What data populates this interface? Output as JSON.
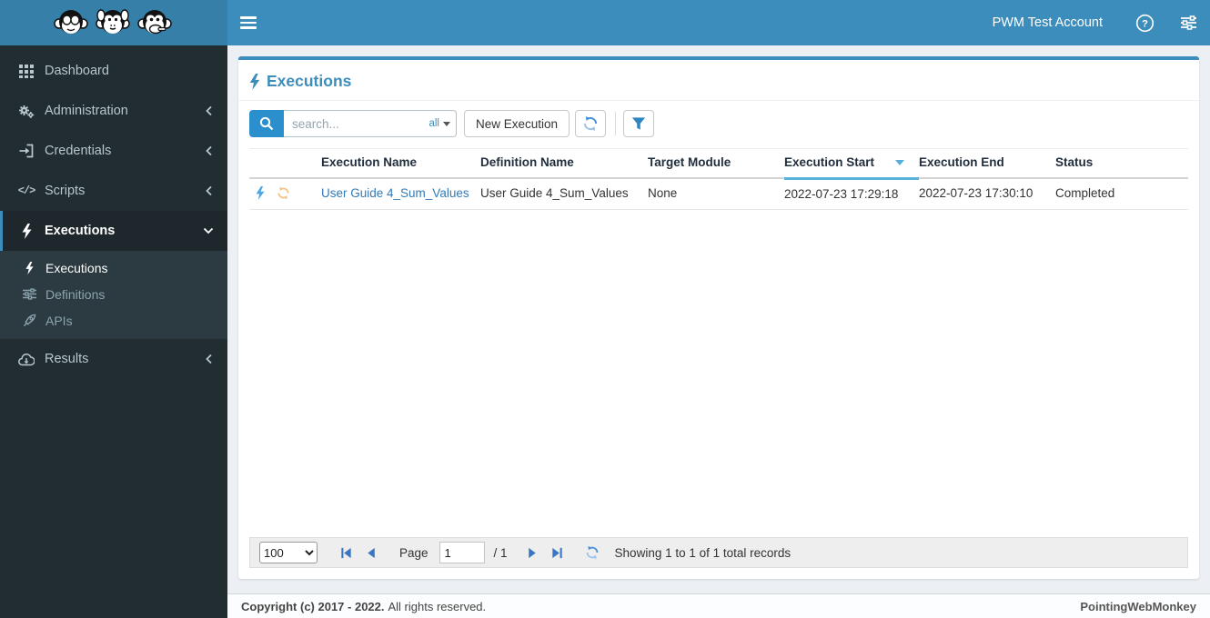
{
  "header": {
    "account_label": "PWM Test Account"
  },
  "sidebar": {
    "items": [
      {
        "label": "Dashboard",
        "icon": "grid-icon"
      },
      {
        "label": "Administration",
        "icon": "gears-icon",
        "chevron": "left"
      },
      {
        "label": "Credentials",
        "icon": "sign-in-icon",
        "chevron": "left"
      },
      {
        "label": "Scripts",
        "icon": "code-icon",
        "chevron": "left"
      },
      {
        "label": "Executions",
        "icon": "bolt-icon",
        "chevron": "down",
        "active": true
      },
      {
        "label": "Results",
        "icon": "cloud-download-icon",
        "chevron": "left"
      }
    ],
    "subitems": [
      {
        "label": "Executions",
        "icon": "bolt-icon",
        "active": true
      },
      {
        "label": "Definitions",
        "icon": "sliders-icon"
      },
      {
        "label": "APIs",
        "icon": "rocket-icon"
      }
    ],
    "code_glyph": "</>"
  },
  "main": {
    "title": "Executions",
    "toolbar": {
      "search_placeholder": "search...",
      "search_scope": "all",
      "new_execution_label": "New Execution"
    },
    "table": {
      "columns": [
        "Execution Name",
        "Definition Name",
        "Target Module",
        "Execution Start",
        "Execution End",
        "Status"
      ],
      "sorted_column": "Execution Start",
      "sort_direction": "desc",
      "rows": [
        {
          "execution_name": "User Guide 4_Sum_Values",
          "definition_name": "User Guide 4_Sum_Values",
          "target_module": "None",
          "execution_start": "2022-07-23 17:29:18",
          "execution_end": "2022-07-23 17:30:10",
          "status": "Completed"
        }
      ]
    },
    "pagination": {
      "page_size": "100",
      "page_label": "Page",
      "current_page": "1",
      "total_pages_label": "/ 1",
      "summary": "Showing 1 to 1 of 1 total records"
    }
  },
  "footer": {
    "copyright_bold": "Copyright (c) 2017 - 2022.",
    "copyright_rest": "All rights reserved.",
    "brand": "PointingWebMonkey"
  },
  "icons": {
    "logo": "three-monkeys",
    "menu": "hamburger",
    "help": "question-circle",
    "settings": "sliders",
    "search": "magnifier",
    "refresh": "circular-arrows",
    "filter": "funnel",
    "run": "bolt",
    "rerun": "refresh-orange"
  },
  "colors": {
    "header_blue": "#3c8dbc",
    "logo_blue": "#367fa9",
    "sidebar_dark": "#222d32",
    "submenu_dark": "#2c3b41",
    "content_bg": "#ecf0f5",
    "link_blue": "#337ab7",
    "sort_highlight": "#58b2dc",
    "row_bolt_icon": "#4da6df",
    "row_refresh_icon": "#f0c387"
  }
}
